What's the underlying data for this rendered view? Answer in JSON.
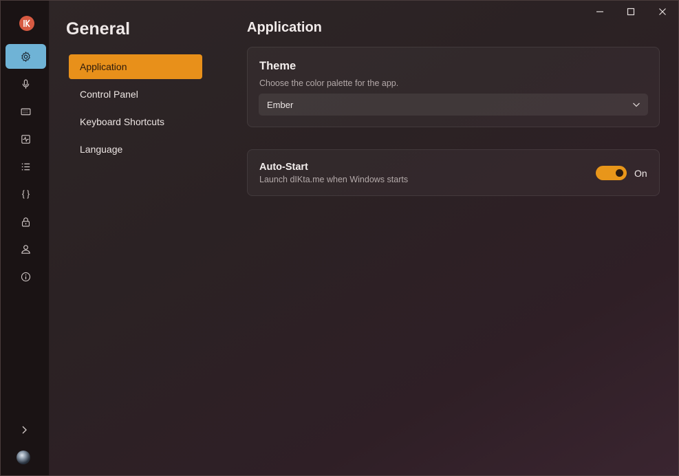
{
  "window": {
    "caption_buttons": [
      "minimize",
      "maximize",
      "close"
    ]
  },
  "rail": {
    "logo_icon": "dikta-logo-icon",
    "items": [
      {
        "icon": "gear-icon",
        "active": true
      },
      {
        "icon": "microphone-icon",
        "active": false
      },
      {
        "icon": "keyboard-icon",
        "active": false
      },
      {
        "icon": "activity-icon",
        "active": false
      },
      {
        "icon": "list-icon",
        "active": false
      },
      {
        "icon": "braces-icon",
        "active": false
      },
      {
        "icon": "lock-icon",
        "active": false
      },
      {
        "icon": "user-icon",
        "active": false
      },
      {
        "icon": "info-icon",
        "active": false
      }
    ],
    "expand_icon": "chevron-right-icon",
    "avatar": "user-avatar"
  },
  "nav": {
    "title": "General",
    "items": [
      {
        "label": "Application",
        "active": true
      },
      {
        "label": "Control Panel",
        "active": false
      },
      {
        "label": "Keyboard Shortcuts",
        "active": false
      },
      {
        "label": "Language",
        "active": false
      }
    ]
  },
  "content": {
    "title": "Application",
    "theme": {
      "title": "Theme",
      "description": "Choose the color palette for the app.",
      "selected": "Ember"
    },
    "autostart": {
      "title": "Auto-Start",
      "description": "Launch dIKta.me when Windows starts",
      "state_label": "On",
      "enabled": true
    }
  },
  "colors": {
    "accent": "#e8901a",
    "rail_active": "#6fb3d6",
    "logo": "#d75a42"
  }
}
